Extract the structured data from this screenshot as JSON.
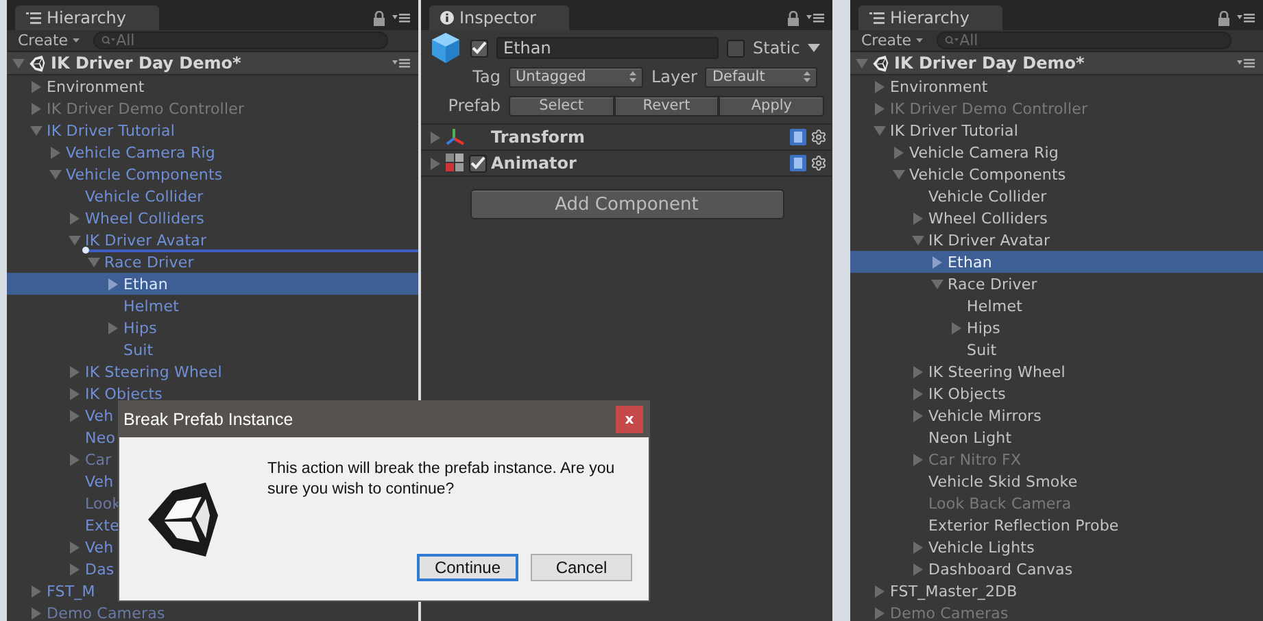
{
  "hierarchy_left": {
    "title": "Hierarchy",
    "create": "Create",
    "search_placeholder": "All",
    "scene": {
      "label": "IK Driver Day Demo*",
      "expanded": true
    },
    "items": [
      {
        "label": "Environment",
        "expanded": false,
        "prefab": false,
        "active": true,
        "selected": false
      },
      {
        "label": "IK Driver Demo Controller",
        "expanded": false,
        "prefab": false,
        "active": false,
        "selected": false
      },
      {
        "label": "IK Driver Tutorial",
        "expanded": true,
        "prefab": true,
        "active": true,
        "selected": false,
        "children": [
          {
            "label": "Vehicle Camera Rig",
            "expanded": false,
            "prefab": true,
            "active": true,
            "selected": false
          },
          {
            "label": "Vehicle Components",
            "expanded": true,
            "prefab": true,
            "active": true,
            "selected": false,
            "children": [
              {
                "label": "Vehicle Collider",
                "prefab": true,
                "active": true,
                "selected": false
              },
              {
                "label": "Wheel Colliders",
                "expanded": false,
                "prefab": true,
                "active": true,
                "selected": false
              },
              {
                "label": "IK Driver Avatar",
                "expanded": true,
                "prefab": true,
                "active": true,
                "selected": false,
                "drop_indicator": true,
                "children": [
                  {
                    "label": "Race Driver",
                    "expanded": true,
                    "prefab": true,
                    "active": true,
                    "selected": false,
                    "children": [
                      {
                        "label": "Ethan",
                        "expanded": false,
                        "prefab": true,
                        "active": true,
                        "selected": true
                      },
                      {
                        "label": "Helmet",
                        "prefab": true,
                        "active": true,
                        "selected": false
                      },
                      {
                        "label": "Hips",
                        "expanded": false,
                        "prefab": true,
                        "active": true,
                        "selected": false
                      },
                      {
                        "label": "Suit",
                        "prefab": true,
                        "active": true,
                        "selected": false
                      }
                    ]
                  }
                ]
              },
              {
                "label": "IK Steering Wheel",
                "expanded": false,
                "prefab": true,
                "active": true,
                "selected": false
              },
              {
                "label": "IK Objects",
                "expanded": false,
                "prefab": true,
                "active": true,
                "selected": false
              },
              {
                "label": "Veh",
                "expanded": false,
                "prefab": true,
                "active": true,
                "selected": false
              },
              {
                "label": "Neo",
                "prefab": true,
                "active": true,
                "selected": false
              },
              {
                "label": "Car",
                "expanded": false,
                "prefab": true,
                "active": false,
                "selected": false
              },
              {
                "label": "Veh",
                "prefab": true,
                "active": true,
                "selected": false
              },
              {
                "label": "Look",
                "prefab": true,
                "active": false,
                "selected": false
              },
              {
                "label": "Exte",
                "prefab": true,
                "active": true,
                "selected": false
              },
              {
                "label": "Veh",
                "expanded": false,
                "prefab": true,
                "active": true,
                "selected": false
              },
              {
                "label": "Das",
                "expanded": false,
                "prefab": true,
                "active": true,
                "selected": false
              }
            ]
          }
        ]
      },
      {
        "label": "FST_M",
        "expanded": false,
        "prefab": true,
        "active": true,
        "selected": false
      },
      {
        "label": "Demo Cameras",
        "expanded": false,
        "prefab": true,
        "active": false,
        "selected": false
      }
    ]
  },
  "inspector": {
    "title": "Inspector",
    "object": {
      "active": true,
      "name": "Ethan",
      "static": false,
      "static_label": "Static",
      "tag_label": "Tag",
      "tag": "Untagged",
      "layer_label": "Layer",
      "layer": "Default",
      "prefab_label": "Prefab",
      "prefab_buttons": [
        "Select",
        "Revert",
        "Apply"
      ]
    },
    "components": [
      {
        "name": "Transform",
        "kind": "transform"
      },
      {
        "name": "Animator",
        "kind": "animator",
        "enabled": true
      }
    ],
    "add_button": "Add Component"
  },
  "hierarchy_right": {
    "title": "Hierarchy",
    "create": "Create",
    "search_placeholder": "All",
    "scene": {
      "label": "IK Driver Day Demo*",
      "expanded": true
    },
    "items": [
      {
        "label": "Environment",
        "expanded": false,
        "prefab": false,
        "active": true,
        "selected": false
      },
      {
        "label": "IK Driver Demo Controller",
        "expanded": false,
        "prefab": false,
        "active": false,
        "selected": false
      },
      {
        "label": "IK Driver Tutorial",
        "expanded": true,
        "prefab": false,
        "active": true,
        "selected": false,
        "children": [
          {
            "label": "Vehicle Camera Rig",
            "expanded": false,
            "prefab": false,
            "active": true,
            "selected": false
          },
          {
            "label": "Vehicle Components",
            "expanded": true,
            "prefab": false,
            "active": true,
            "selected": false,
            "children": [
              {
                "label": "Vehicle Collider",
                "prefab": false,
                "active": true,
                "selected": false
              },
              {
                "label": "Wheel Colliders",
                "expanded": false,
                "prefab": false,
                "active": true,
                "selected": false
              },
              {
                "label": "IK Driver Avatar",
                "expanded": true,
                "prefab": false,
                "active": true,
                "selected": false,
                "children": [
                  {
                    "label": "Ethan",
                    "expanded": false,
                    "prefab": false,
                    "active": true,
                    "selected": true
                  },
                  {
                    "label": "Race Driver",
                    "expanded": true,
                    "prefab": false,
                    "active": true,
                    "selected": false,
                    "children": [
                      {
                        "label": "Helmet",
                        "prefab": false,
                        "active": true,
                        "selected": false
                      },
                      {
                        "label": "Hips",
                        "expanded": false,
                        "prefab": false,
                        "active": true,
                        "selected": false
                      },
                      {
                        "label": "Suit",
                        "prefab": false,
                        "active": true,
                        "selected": false
                      }
                    ]
                  }
                ]
              },
              {
                "label": "IK Steering Wheel",
                "expanded": false,
                "prefab": false,
                "active": true,
                "selected": false
              },
              {
                "label": "IK Objects",
                "expanded": false,
                "prefab": false,
                "active": true,
                "selected": false
              },
              {
                "label": "Vehicle Mirrors",
                "expanded": false,
                "prefab": false,
                "active": true,
                "selected": false
              },
              {
                "label": "Neon Light",
                "prefab": false,
                "active": true,
                "selected": false
              },
              {
                "label": "Car Nitro FX",
                "expanded": false,
                "prefab": false,
                "active": false,
                "selected": false
              },
              {
                "label": "Vehicle Skid Smoke",
                "prefab": false,
                "active": true,
                "selected": false
              },
              {
                "label": "Look Back Camera",
                "prefab": false,
                "active": false,
                "selected": false
              },
              {
                "label": "Exterior Reflection Probe",
                "prefab": false,
                "active": true,
                "selected": false
              },
              {
                "label": "Vehicle Lights",
                "expanded": false,
                "prefab": false,
                "active": true,
                "selected": false
              },
              {
                "label": "Dashboard Canvas",
                "expanded": false,
                "prefab": false,
                "active": true,
                "selected": false
              }
            ]
          }
        ]
      },
      {
        "label": "FST_Master_2DB",
        "expanded": false,
        "prefab": false,
        "active": true,
        "selected": false
      },
      {
        "label": "Demo Cameras",
        "expanded": false,
        "prefab": false,
        "active": false,
        "selected": false
      }
    ]
  },
  "dialog": {
    "title": "Break Prefab Instance",
    "close_label": "x",
    "message": "This action will break the prefab instance. Are you sure you wish to continue?",
    "buttons": [
      {
        "label": "Continue",
        "focused": true
      },
      {
        "label": "Cancel",
        "focused": false
      }
    ]
  }
}
